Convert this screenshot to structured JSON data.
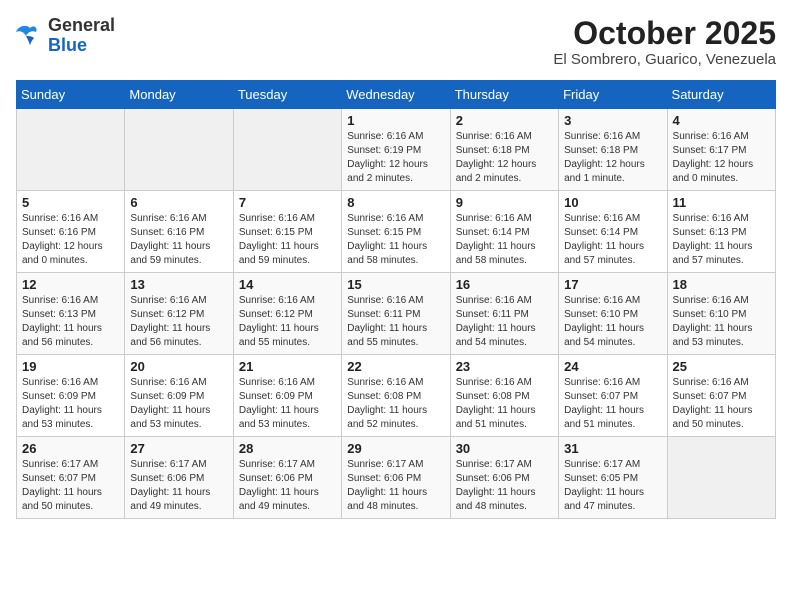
{
  "header": {
    "logo_general": "General",
    "logo_blue": "Blue",
    "month": "October 2025",
    "location": "El Sombrero, Guarico, Venezuela"
  },
  "days_of_week": [
    "Sunday",
    "Monday",
    "Tuesday",
    "Wednesday",
    "Thursday",
    "Friday",
    "Saturday"
  ],
  "weeks": [
    [
      {
        "day": "",
        "info": ""
      },
      {
        "day": "",
        "info": ""
      },
      {
        "day": "",
        "info": ""
      },
      {
        "day": "1",
        "info": "Sunrise: 6:16 AM\nSunset: 6:19 PM\nDaylight: 12 hours and 2 minutes."
      },
      {
        "day": "2",
        "info": "Sunrise: 6:16 AM\nSunset: 6:18 PM\nDaylight: 12 hours and 2 minutes."
      },
      {
        "day": "3",
        "info": "Sunrise: 6:16 AM\nSunset: 6:18 PM\nDaylight: 12 hours and 1 minute."
      },
      {
        "day": "4",
        "info": "Sunrise: 6:16 AM\nSunset: 6:17 PM\nDaylight: 12 hours and 0 minutes."
      }
    ],
    [
      {
        "day": "5",
        "info": "Sunrise: 6:16 AM\nSunset: 6:16 PM\nDaylight: 12 hours and 0 minutes."
      },
      {
        "day": "6",
        "info": "Sunrise: 6:16 AM\nSunset: 6:16 PM\nDaylight: 11 hours and 59 minutes."
      },
      {
        "day": "7",
        "info": "Sunrise: 6:16 AM\nSunset: 6:15 PM\nDaylight: 11 hours and 59 minutes."
      },
      {
        "day": "8",
        "info": "Sunrise: 6:16 AM\nSunset: 6:15 PM\nDaylight: 11 hours and 58 minutes."
      },
      {
        "day": "9",
        "info": "Sunrise: 6:16 AM\nSunset: 6:14 PM\nDaylight: 11 hours and 58 minutes."
      },
      {
        "day": "10",
        "info": "Sunrise: 6:16 AM\nSunset: 6:14 PM\nDaylight: 11 hours and 57 minutes."
      },
      {
        "day": "11",
        "info": "Sunrise: 6:16 AM\nSunset: 6:13 PM\nDaylight: 11 hours and 57 minutes."
      }
    ],
    [
      {
        "day": "12",
        "info": "Sunrise: 6:16 AM\nSunset: 6:13 PM\nDaylight: 11 hours and 56 minutes."
      },
      {
        "day": "13",
        "info": "Sunrise: 6:16 AM\nSunset: 6:12 PM\nDaylight: 11 hours and 56 minutes."
      },
      {
        "day": "14",
        "info": "Sunrise: 6:16 AM\nSunset: 6:12 PM\nDaylight: 11 hours and 55 minutes."
      },
      {
        "day": "15",
        "info": "Sunrise: 6:16 AM\nSunset: 6:11 PM\nDaylight: 11 hours and 55 minutes."
      },
      {
        "day": "16",
        "info": "Sunrise: 6:16 AM\nSunset: 6:11 PM\nDaylight: 11 hours and 54 minutes."
      },
      {
        "day": "17",
        "info": "Sunrise: 6:16 AM\nSunset: 6:10 PM\nDaylight: 11 hours and 54 minutes."
      },
      {
        "day": "18",
        "info": "Sunrise: 6:16 AM\nSunset: 6:10 PM\nDaylight: 11 hours and 53 minutes."
      }
    ],
    [
      {
        "day": "19",
        "info": "Sunrise: 6:16 AM\nSunset: 6:09 PM\nDaylight: 11 hours and 53 minutes."
      },
      {
        "day": "20",
        "info": "Sunrise: 6:16 AM\nSunset: 6:09 PM\nDaylight: 11 hours and 53 minutes."
      },
      {
        "day": "21",
        "info": "Sunrise: 6:16 AM\nSunset: 6:09 PM\nDaylight: 11 hours and 53 minutes."
      },
      {
        "day": "22",
        "info": "Sunrise: 6:16 AM\nSunset: 6:08 PM\nDaylight: 11 hours and 52 minutes."
      },
      {
        "day": "23",
        "info": "Sunrise: 6:16 AM\nSunset: 6:08 PM\nDaylight: 11 hours and 51 minutes."
      },
      {
        "day": "24",
        "info": "Sunrise: 6:16 AM\nSunset: 6:07 PM\nDaylight: 11 hours and 51 minutes."
      },
      {
        "day": "25",
        "info": "Sunrise: 6:16 AM\nSunset: 6:07 PM\nDaylight: 11 hours and 50 minutes."
      }
    ],
    [
      {
        "day": "26",
        "info": "Sunrise: 6:17 AM\nSunset: 6:07 PM\nDaylight: 11 hours and 50 minutes."
      },
      {
        "day": "27",
        "info": "Sunrise: 6:17 AM\nSunset: 6:06 PM\nDaylight: 11 hours and 49 minutes."
      },
      {
        "day": "28",
        "info": "Sunrise: 6:17 AM\nSunset: 6:06 PM\nDaylight: 11 hours and 49 minutes."
      },
      {
        "day": "29",
        "info": "Sunrise: 6:17 AM\nSunset: 6:06 PM\nDaylight: 11 hours and 48 minutes."
      },
      {
        "day": "30",
        "info": "Sunrise: 6:17 AM\nSunset: 6:06 PM\nDaylight: 11 hours and 48 minutes."
      },
      {
        "day": "31",
        "info": "Sunrise: 6:17 AM\nSunset: 6:05 PM\nDaylight: 11 hours and 47 minutes."
      },
      {
        "day": "",
        "info": ""
      }
    ]
  ]
}
